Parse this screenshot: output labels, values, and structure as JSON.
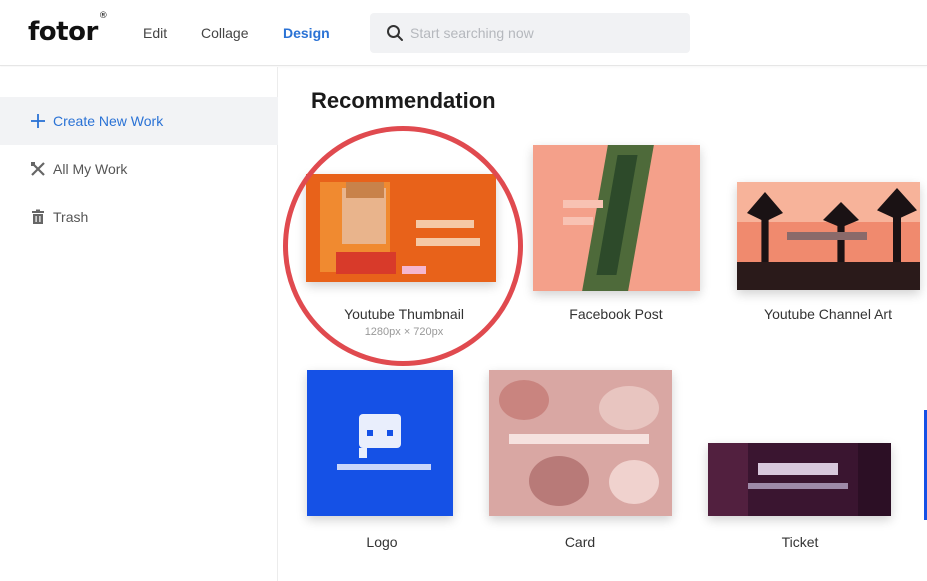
{
  "header": {
    "logo_text": "fotor",
    "logo_mark": "®",
    "nav": [
      {
        "label": "Edit"
      },
      {
        "label": "Collage"
      },
      {
        "label": "Design"
      }
    ],
    "active_nav": "Design",
    "search": {
      "placeholder": "Start searching now",
      "value": ""
    }
  },
  "sidebar": {
    "items": [
      {
        "label": "Create New Work",
        "icon": "plus-icon",
        "active": true
      },
      {
        "label": "All My Work",
        "icon": "tools-icon",
        "active": false
      },
      {
        "label": "Trash",
        "icon": "trash-icon",
        "active": false
      }
    ]
  },
  "main": {
    "title": "Recommendation",
    "templates": [
      {
        "label": "Youtube Thumbnail",
        "size": "1280px × 720px",
        "highlighted": true
      },
      {
        "label": "Facebook Post"
      },
      {
        "label": "Youtube Channel Art"
      },
      {
        "label": "Logo"
      },
      {
        "label": "Card"
      },
      {
        "label": "Ticket"
      }
    ]
  },
  "colors": {
    "accent": "#2a72d5",
    "highlight_ring": "#e04a4f",
    "youtube_thumb": "#e8621a",
    "facebook_post": "#f4a08a",
    "channel_art": "#f08a6e",
    "logo_bg": "#1551e6",
    "card_bg": "#d9a7a3",
    "ticket_bg": "#3a1530"
  }
}
